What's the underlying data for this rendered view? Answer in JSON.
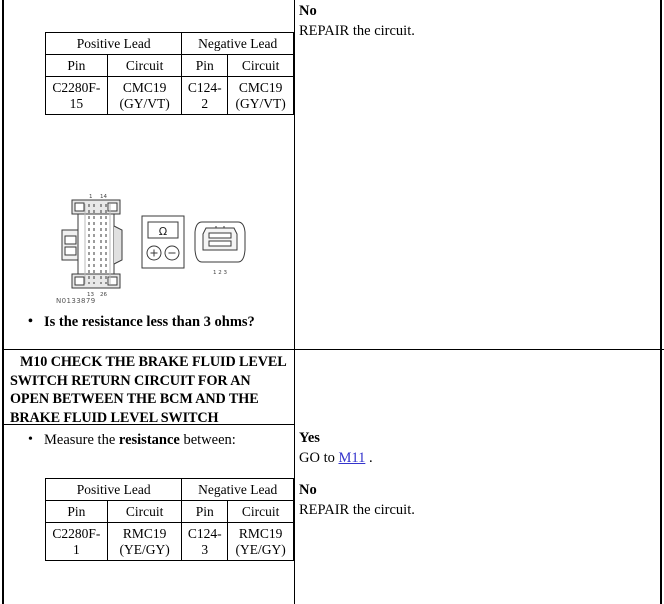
{
  "document": {
    "type": "automotive-diagnostic-pinpoint-test"
  },
  "step_previous": {
    "answer_no": {
      "label": "No",
      "text": "REPAIR the circuit."
    },
    "pin_table": {
      "group_headers": [
        "Positive Lead",
        "Negative Lead"
      ],
      "column_headers": [
        "Pin",
        "Circuit",
        "Pin",
        "Circuit"
      ],
      "rows": [
        {
          "positive_pin_line1": "C2280F-",
          "positive_pin_line2": "15",
          "positive_circuit_line1": "CMC19",
          "positive_circuit_line2": "(GY/VT)",
          "negative_pin_line1": "C124-",
          "negative_pin_line2": "2",
          "negative_circuit_line1": "CMC19",
          "negative_circuit_line2": "(GY/VT)"
        }
      ]
    },
    "figure": {
      "id": "N0133879",
      "left_connector": {
        "top_pins": "1  14",
        "bottom_pins": "13  26"
      },
      "meter": {
        "display_symbol": "Ω",
        "positive_terminal": "+",
        "negative_terminal": "−"
      },
      "right_connector": {
        "pins": "1  2  3"
      }
    },
    "question": "Is the resistance less than 3 ohms?"
  },
  "step_m10": {
    "heading_lines": [
      "M10 CHECK THE BRAKE FLUID LEVEL",
      "SWITCH RETURN CIRCUIT FOR AN",
      "OPEN BETWEEN THE BCM AND THE",
      "BRAKE FLUID LEVEL SWITCH"
    ],
    "instruction": {
      "prefix": "Measure the ",
      "emphasis": "resistance",
      "suffix": " between:"
    },
    "pin_table": {
      "group_headers": [
        "Positive Lead",
        "Negative Lead"
      ],
      "column_headers": [
        "Pin",
        "Circuit",
        "Pin",
        "Circuit"
      ],
      "rows": [
        {
          "positive_pin_line1": "C2280F-",
          "positive_pin_line2": "1",
          "positive_circuit_line1": "RMC19",
          "positive_circuit_line2": "(YE/GY)",
          "negative_pin_line1": "C124-",
          "negative_pin_line2": "3",
          "negative_circuit_line1": "RMC19",
          "negative_circuit_line2": "(YE/GY)"
        }
      ]
    },
    "answer_yes": {
      "label": "Yes",
      "prefix": "GO to ",
      "link": "M11",
      "suffix": " ."
    },
    "answer_no": {
      "label": "No",
      "text": "REPAIR the circuit."
    }
  },
  "colors": {
    "link": "#3333cc",
    "border": "#000000",
    "background": "#ffffff",
    "figure_line": "#333333"
  }
}
